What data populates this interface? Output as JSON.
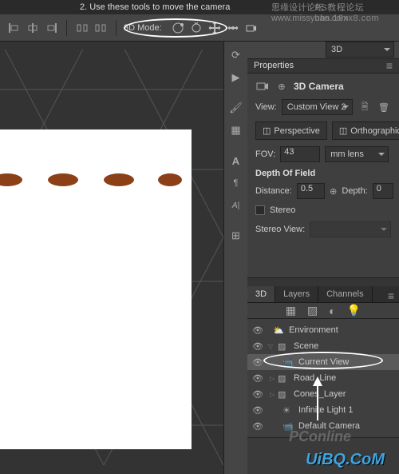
{
  "instruction": "2. Use these tools to move the camera",
  "options_bar": {
    "mode_label": "3D Mode:",
    "right_dropdown": "3D"
  },
  "properties": {
    "panel_title": "Properties",
    "section_title": "3D Camera",
    "view_label": "View:",
    "view_value": "Custom View 2",
    "perspective": "Perspective",
    "orthographic": "Orthographic",
    "fov_label": "FOV:",
    "fov_value": "43",
    "fov_unit": "mm lens",
    "dof_title": "Depth Of Field",
    "distance_label": "Distance:",
    "distance_value": "0.5",
    "depth_label": "Depth:",
    "depth_value": "0",
    "stereo_label": "Stereo",
    "stereo_view_label": "Stereo View:"
  },
  "three_d_panel": {
    "tabs": [
      "3D",
      "Layers",
      "Channels"
    ],
    "items": [
      {
        "label": "Environment",
        "icon": "env"
      },
      {
        "label": "Scene",
        "icon": "scene"
      },
      {
        "label": "Current View",
        "icon": "camera"
      },
      {
        "label": "Road_Line",
        "icon": "mesh"
      },
      {
        "label": "Cones_Layer",
        "icon": "mesh"
      },
      {
        "label": "Infinite Light 1",
        "icon": "light"
      },
      {
        "label": "Default Camera",
        "icon": "camera"
      }
    ]
  },
  "watermarks": {
    "top_cn": "思缘设计论坛",
    "top_url": "www.missyuan.com",
    "top_right": "bbs.16xx8.com",
    "top_right_cn": "PS教程论坛",
    "bottom": "UiBQ.CoM",
    "pc": "PConline"
  }
}
